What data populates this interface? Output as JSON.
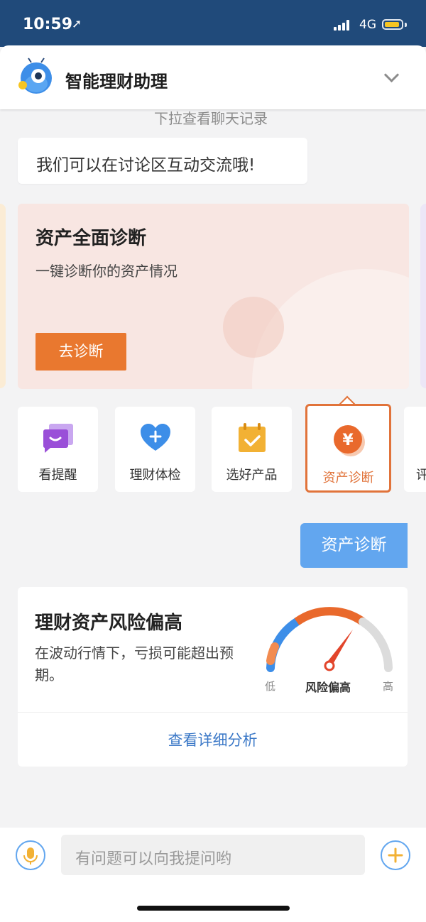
{
  "status_bar": {
    "time": "10:59",
    "network": "4G"
  },
  "header": {
    "title": "智能理财助理"
  },
  "chat": {
    "pull_hint": "下拉查看聊天记录",
    "bot_message": "我们可以在讨论区互动交流哦!",
    "user_message": "资产诊断"
  },
  "diagnosis_card": {
    "title": "资产全面诊断",
    "subtitle": "一键诊断你的资产情况",
    "button": "去诊断"
  },
  "quick_actions": [
    {
      "label": "看提醒",
      "icon": "chat-bubble-icon"
    },
    {
      "label": "理财体检",
      "icon": "heart-plus-icon"
    },
    {
      "label": "选好产品",
      "icon": "calendar-check-icon"
    },
    {
      "label": "资产诊断",
      "icon": "yen-circle-icon",
      "active": true
    },
    {
      "label": "评"
    }
  ],
  "risk_card": {
    "title": "理财资产风险偏高",
    "description": "在波动行情下，亏损可能超出预期。",
    "gauge": {
      "low": "低",
      "current": "风险偏高",
      "high": "高",
      "level": 0.8
    },
    "link": "查看详细分析"
  },
  "input_bar": {
    "placeholder": "有问题可以向我提问哟"
  },
  "colors": {
    "accent": "#e1733a",
    "brand_blue": "#62a6ef",
    "status_bar": "#204a7a",
    "link": "#3b78c7"
  }
}
